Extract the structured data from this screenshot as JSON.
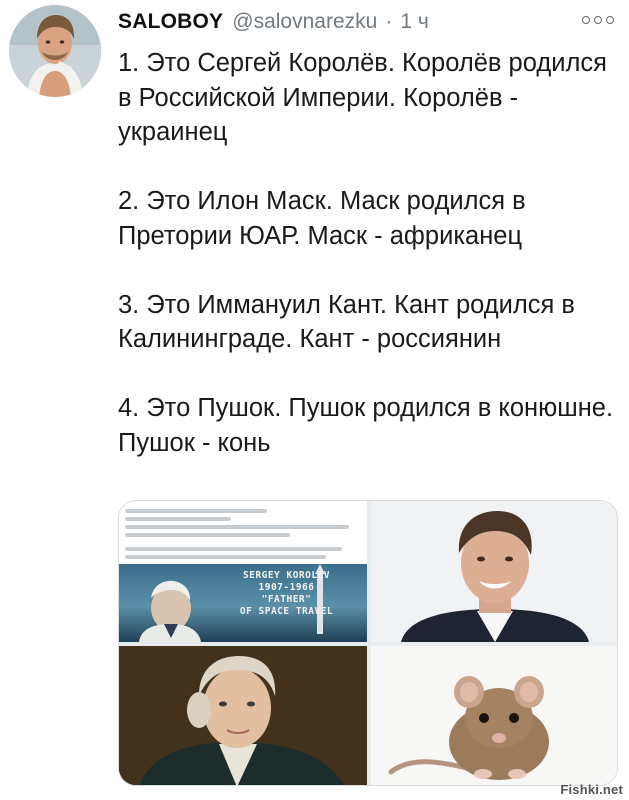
{
  "tweet": {
    "display_name": "SALOBOY",
    "handle": "@salovnarezku",
    "separator": "·",
    "time": "1 ч",
    "paragraphs": [
      "1. Это Сергей Королёв. Королёв родился в Российской Империи. Королёв - украинец",
      "2. Это Илон Маск. Маск родился в Претории ЮАР. Маск - африканец",
      "3. Это Иммануил Кант. Кант родился в Калининграде. Кант - россиянин",
      "4. Это Пушок. Пушок родился в конюшне. Пушок - конь"
    ]
  },
  "media": {
    "korolev_banner": [
      "SERGEY KOROLEV",
      "1907-1966",
      "\"FATHER\"",
      "OF SPACE TRAVEL"
    ]
  },
  "watermark": "Fishki.net",
  "icons": {
    "more": "more-horizontal-icon"
  }
}
